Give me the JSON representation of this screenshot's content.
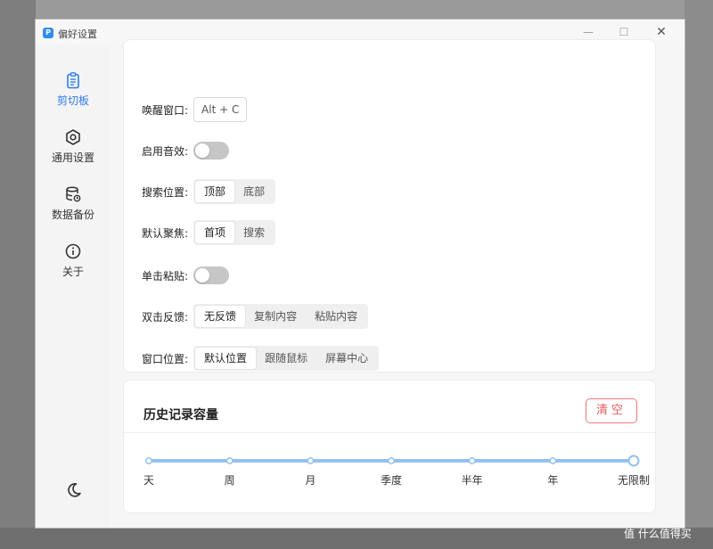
{
  "window": {
    "title": "偏好设置",
    "app_icon_glyph": "P",
    "min_glyph": "—",
    "max_glyph": "☐",
    "close_glyph": "✕"
  },
  "sidebar": {
    "items": [
      {
        "label": "剪切板",
        "icon": "clipboard-icon",
        "active": true
      },
      {
        "label": "通用设置",
        "icon": "hexagon-gear-icon",
        "active": false
      },
      {
        "label": "数据备份",
        "icon": "database-sync-icon",
        "active": false
      },
      {
        "label": "关于",
        "icon": "info-circle-icon",
        "active": false
      }
    ],
    "theme_icon": "moon-icon"
  },
  "settings": {
    "wake_window": {
      "label": "唤醒窗口:",
      "value": "Alt + C"
    },
    "sound": {
      "label": "启用音效:",
      "enabled": false
    },
    "search_position": {
      "label": "搜索位置:",
      "options": [
        "顶部",
        "底部"
      ],
      "selected": "顶部"
    },
    "default_focus": {
      "label": "默认聚焦:",
      "options": [
        "首项",
        "搜索"
      ],
      "selected": "首项"
    },
    "single_click_paste": {
      "label": "单击粘贴:",
      "enabled": false
    },
    "double_click_feedback": {
      "label": "双击反馈:",
      "options": [
        "无反馈",
        "复制内容",
        "粘贴内容"
      ],
      "selected": "无反馈"
    },
    "window_position": {
      "label": "窗口位置:",
      "options": [
        "默认位置",
        "跟随鼠标",
        "屏幕中心"
      ],
      "selected": "默认位置"
    }
  },
  "history": {
    "title": "历史记录容量",
    "clear_label": "清空",
    "slider_marks": [
      "天",
      "周",
      "月",
      "季度",
      "半年",
      "年",
      "无限制"
    ],
    "selected": "无限制"
  },
  "watermark": "值 什么值得买",
  "colors": {
    "accent": "#2f7bea",
    "danger": "#e55c5c",
    "slider": "#93c1f0"
  }
}
